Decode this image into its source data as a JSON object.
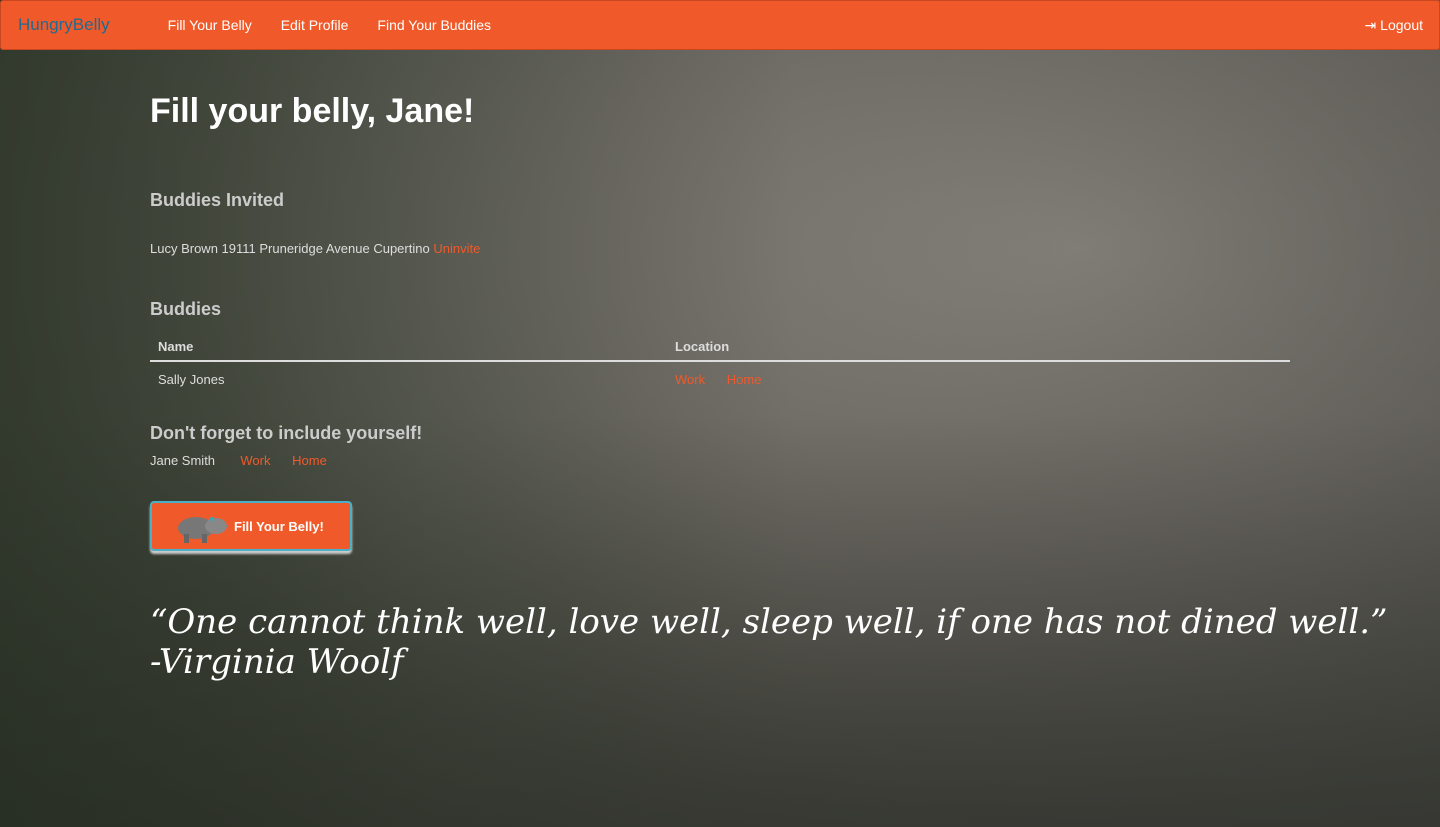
{
  "nav": {
    "brand": "HungryBelly",
    "links": [
      "Fill Your Belly",
      "Edit Profile",
      "Find Your Buddies"
    ],
    "logout": "Logout"
  },
  "page": {
    "title": "Fill your belly, Jane!",
    "invited_heading": "Buddies Invited",
    "invited": {
      "text": "Lucy Brown 19111 Pruneridge Avenue Cupertino",
      "action": "Uninvite"
    },
    "buddies_heading": "Buddies",
    "columns": [
      "Name",
      "Location"
    ],
    "rows": [
      {
        "name": "Sally Jones",
        "locations": [
          "Work",
          "Home"
        ]
      }
    ],
    "self_heading": "Don't forget to include yourself!",
    "self": {
      "name": "Jane Smith",
      "locations": [
        "Work",
        "Home"
      ]
    },
    "button": "Fill Your Belly!",
    "quote": "“One cannot think well, love well, sleep well, if one has not dined well.”",
    "quote_author": "-Virginia Woolf"
  },
  "colors": {
    "accent": "#f05a2a",
    "brand": "#1f6b91"
  }
}
